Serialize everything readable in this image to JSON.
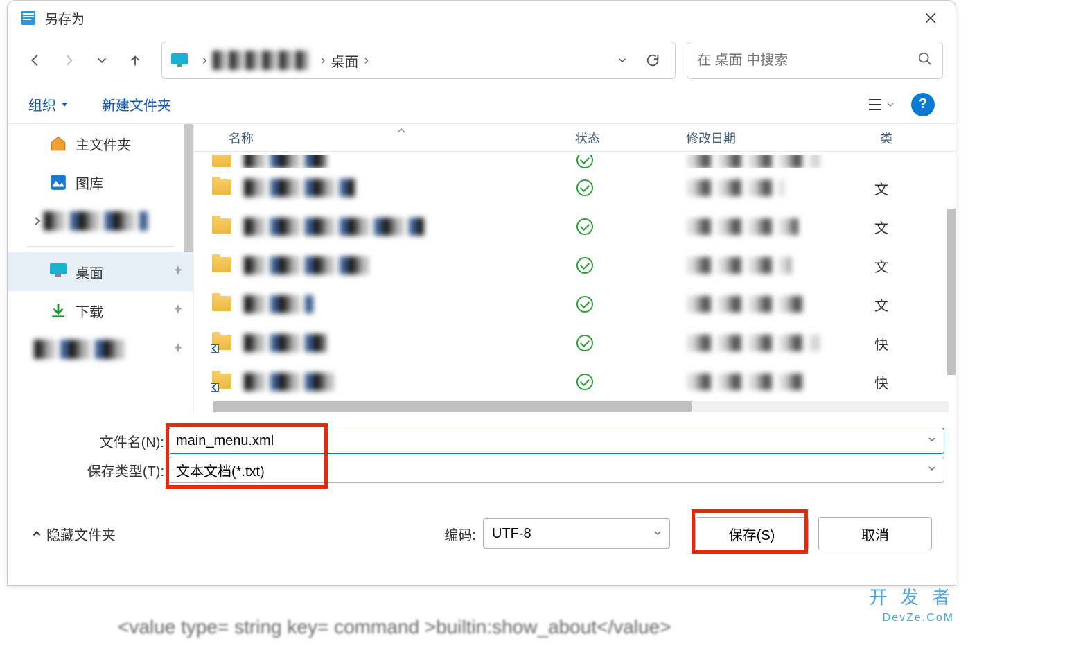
{
  "dialog": {
    "title": "另存为",
    "breadcrumb": {
      "current": "桌面"
    },
    "search_placeholder": "在 桌面 中搜索",
    "toolbar": {
      "organize": "组织",
      "new_folder": "新建文件夹"
    },
    "sidebar": {
      "home": "主文件夹",
      "gallery": "图库",
      "desktop": "桌面",
      "downloads": "下载"
    },
    "columns": {
      "name": "名称",
      "status": "状态",
      "date": "修改日期",
      "type": "类"
    },
    "rows": [
      {
        "type_label": ""
      },
      {
        "type_label": "文"
      },
      {
        "type_label": "文"
      },
      {
        "type_label": "文"
      },
      {
        "type_label": "文"
      },
      {
        "type_label": "快"
      },
      {
        "type_label": "快"
      }
    ],
    "filename_label": "文件名(N):",
    "filename_value": "main_menu.xml",
    "savetype_label": "保存类型(T):",
    "savetype_value": "文本文档(*.txt)",
    "hide_folders": "隐藏文件夹",
    "encoding_label": "编码:",
    "encoding_value": "UTF-8",
    "save_button": "保存(S)",
    "cancel_button": "取消"
  },
  "watermark": {
    "line1": "开 发 者",
    "line2": "DevZe.CoM"
  },
  "bg_code": "<value type= string  key= command >builtin:show_about</value>"
}
